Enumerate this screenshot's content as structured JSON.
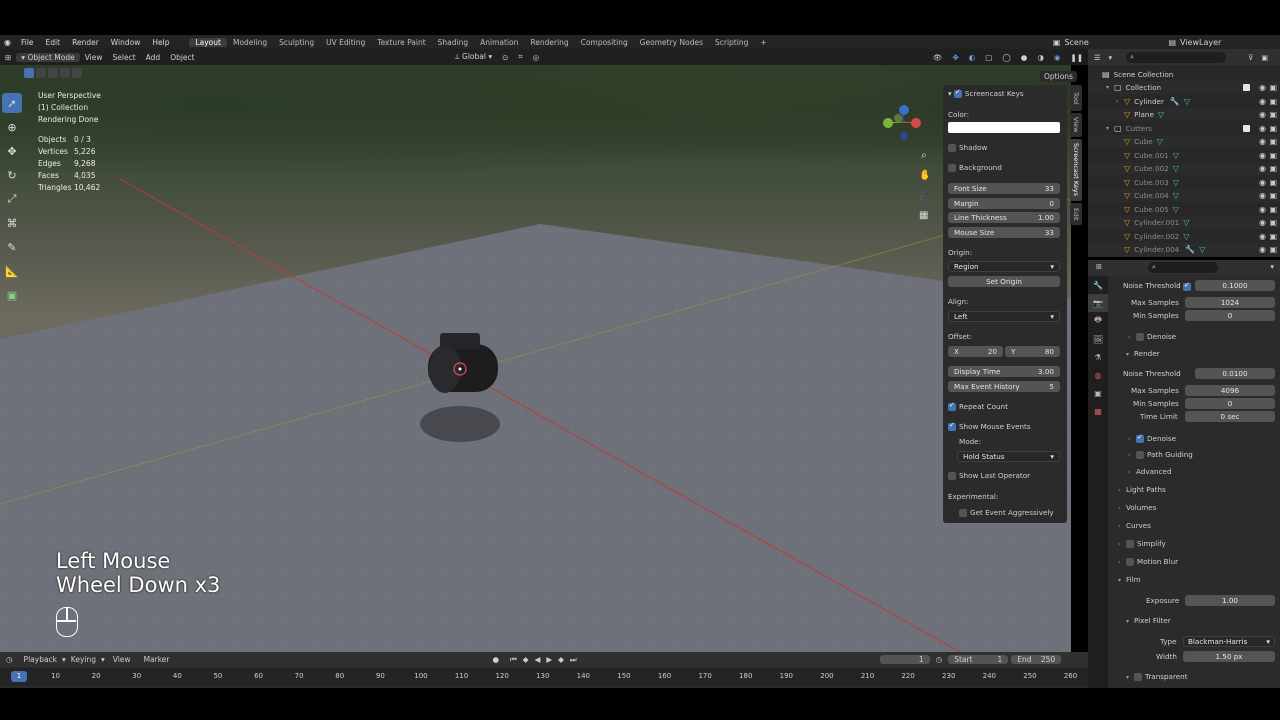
{
  "menu": {
    "items": [
      "File",
      "Edit",
      "Render",
      "Window",
      "Help"
    ]
  },
  "workspaces": {
    "tabs": [
      "Layout",
      "Modeling",
      "Sculpting",
      "UV Editing",
      "Texture Paint",
      "Shading",
      "Animation",
      "Rendering",
      "Compositing",
      "Geometry Nodes",
      "Scripting"
    ],
    "active": "Layout"
  },
  "scene": {
    "name": "Scene",
    "view_layer": "ViewLayer"
  },
  "viewport_header": {
    "mode": "Object Mode",
    "menus": [
      "View",
      "Select",
      "Add",
      "Object"
    ],
    "transform": "Global",
    "options": "Options"
  },
  "overlay": {
    "perspective": "User Perspective",
    "collection": "(1) Collection",
    "status": "Rendering Done",
    "stats": [
      {
        "label": "Objects",
        "value": "0 / 3"
      },
      {
        "label": "Vertices",
        "value": "5,226"
      },
      {
        "label": "Edges",
        "value": "9,268"
      },
      {
        "label": "Faces",
        "value": "4,035"
      },
      {
        "label": "Triangles",
        "value": "10,462"
      }
    ]
  },
  "screencast_overlay": {
    "line1": "Left Mouse",
    "line2": "Wheel Down x3"
  },
  "screencast_panel": {
    "title": "Screencast Keys",
    "color_label": "Color:",
    "shadow": "Shadow",
    "background": "Background",
    "font_size": {
      "label": "Font Size",
      "value": "33"
    },
    "margin": {
      "label": "Margin",
      "value": "0"
    },
    "line_thickness": {
      "label": "Line Thickness",
      "value": "1.00"
    },
    "mouse_size": {
      "label": "Mouse Size",
      "value": "33"
    },
    "origin_label": "Origin:",
    "origin_value": "Region",
    "set_origin": "Set Origin",
    "align_label": "Align:",
    "align_value": "Left",
    "offset_label": "Offset:",
    "offset_x_label": "X",
    "offset_x": "20",
    "offset_y_label": "Y",
    "offset_y": "80",
    "display_time": {
      "label": "Display Time",
      "value": "3.00"
    },
    "max_history": {
      "label": "Max Event History",
      "value": "5"
    },
    "repeat_count": "Repeat Count",
    "show_mouse_events": "Show Mouse Events",
    "mode_label": "Mode:",
    "mode_value": "Hold Status",
    "show_last_operator": "Show Last Operator",
    "experimental_label": "Experimental:",
    "get_event_aggressively": "Get Event Aggressively"
  },
  "side_tabs": [
    "Tool",
    "View",
    "Screencast Keys",
    "Edit"
  ],
  "outliner": {
    "root": "Scene Collection",
    "rows": [
      {
        "name": "Collection",
        "type": "collection",
        "indent": 1
      },
      {
        "name": "Cylinder",
        "type": "mesh",
        "indent": 2
      },
      {
        "name": "Plane",
        "type": "mesh",
        "indent": 2
      },
      {
        "name": "Cutters",
        "type": "collection",
        "indent": 1
      },
      {
        "name": "Cube",
        "type": "mesh",
        "indent": 2
      },
      {
        "name": "Cube.001",
        "type": "mesh",
        "indent": 2
      },
      {
        "name": "Cube.002",
        "type": "mesh",
        "indent": 2
      },
      {
        "name": "Cube.003",
        "type": "mesh",
        "indent": 2
      },
      {
        "name": "Cube.004",
        "type": "mesh",
        "indent": 2
      },
      {
        "name": "Cube.005",
        "type": "mesh",
        "indent": 2
      },
      {
        "name": "Cylinder.001",
        "type": "mesh",
        "indent": 2
      },
      {
        "name": "Cylinder.002",
        "type": "mesh",
        "indent": 2
      },
      {
        "name": "Cylinder.004",
        "type": "mesh",
        "indent": 2
      }
    ]
  },
  "properties": {
    "viewport_noise_threshold": {
      "label": "Noise Threshold",
      "value": "0.1000"
    },
    "viewport_max_samples": {
      "label": "Max Samples",
      "value": "1024"
    },
    "viewport_min_samples": {
      "label": "Min Samples",
      "value": "0"
    },
    "denoise_1": "Denoise",
    "render_section": "Render",
    "render_noise_threshold": {
      "label": "Noise Threshold",
      "value": "0.0100"
    },
    "render_max_samples": {
      "label": "Max Samples",
      "value": "4096"
    },
    "render_min_samples": {
      "label": "Min Samples",
      "value": "0"
    },
    "time_limit": {
      "label": "Time Limit",
      "value": "0 sec"
    },
    "denoise_2": "Denoise",
    "path_guiding": "Path Guiding",
    "advanced": "Advanced",
    "light_paths": "Light Paths",
    "volumes": "Volumes",
    "curves": "Curves",
    "simplify": "Simplify",
    "motion_blur": "Motion Blur",
    "film": "Film",
    "exposure": {
      "label": "Exposure",
      "value": "1.00"
    },
    "pixel_filter": "Pixel Filter",
    "filter_type": {
      "label": "Type",
      "value": "Blackman-Harris"
    },
    "filter_width": {
      "label": "Width",
      "value": "1.50 px"
    },
    "transparent": "Transparent"
  },
  "timeline": {
    "menus": [
      "Playback",
      "Keying",
      "View",
      "Marker"
    ],
    "current_frame": "1",
    "start_label": "Start",
    "start": "1",
    "end_label": "End",
    "end": "250",
    "ticks": [
      "1",
      "10",
      "20",
      "30",
      "40",
      "50",
      "60",
      "70",
      "80",
      "90",
      "100",
      "110",
      "120",
      "130",
      "140",
      "150",
      "160",
      "170",
      "180",
      "190",
      "200",
      "210",
      "220",
      "230",
      "240",
      "250",
      "260"
    ]
  },
  "colors": {
    "accent": "#4772b3",
    "mesh": "#e09a3a",
    "panel": "#2b2b2b",
    "x_axis": "#c2393a",
    "y_axis": "#8aa83a"
  }
}
